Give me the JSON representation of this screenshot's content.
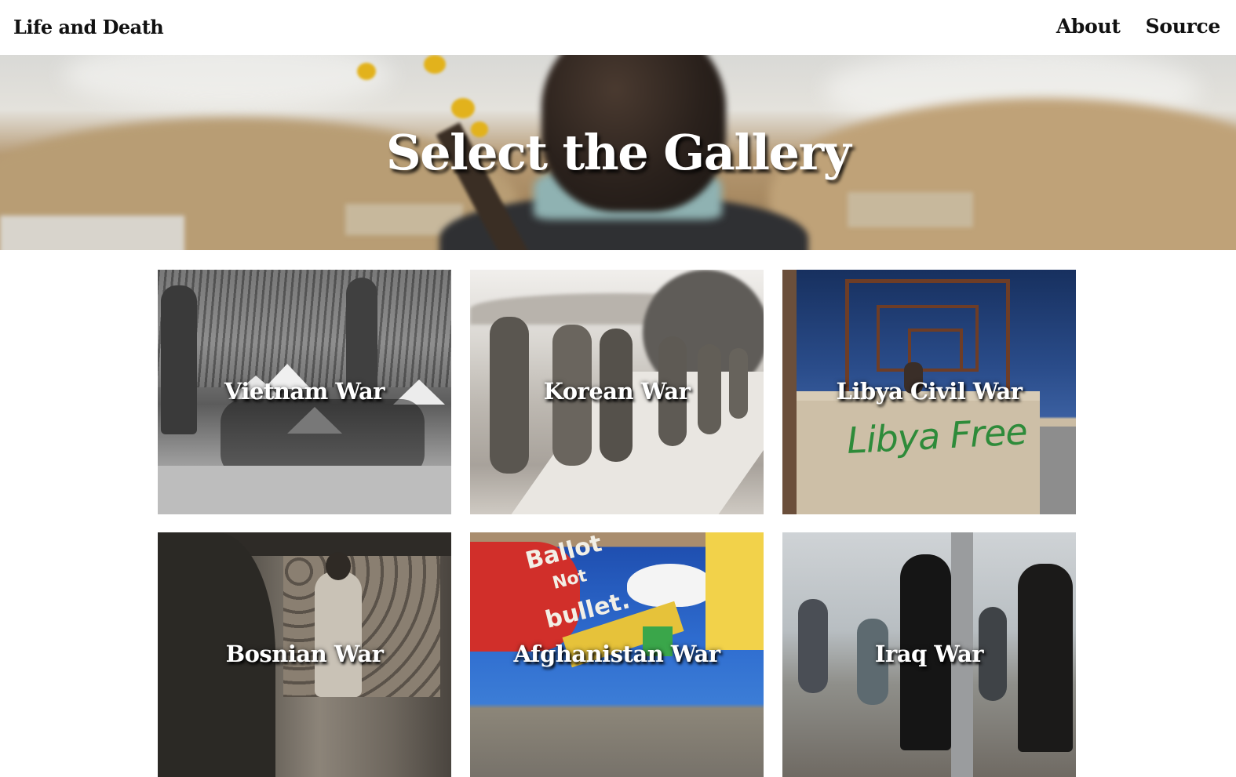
{
  "navbar": {
    "brand": "Life and Death",
    "links": [
      "About",
      "Source"
    ]
  },
  "hero": {
    "title": "Select the Gallery"
  },
  "gallery": {
    "cards": [
      {
        "label": "Vietnam War",
        "photo": "black-and-white photo of soldiers and villagers in conical hats"
      },
      {
        "label": "Korean War",
        "photo": "sepia photo of refugees walking along a path"
      },
      {
        "label": "Libya Civil War",
        "photo": "wall with green graffiti and metal frame against blue sky"
      },
      {
        "label": "Bosnian War",
        "photo": "black-and-white photo of woman walking past sandbags and soldier"
      },
      {
        "label": "Afghanistan War",
        "photo": "colorful mural with dove and children"
      },
      {
        "label": "Iraq War",
        "photo": "women and children walking in a dusty landscape"
      }
    ]
  },
  "mural_text": {
    "ballot": "Ballot",
    "not": "Not",
    "bullet": "bullet."
  },
  "graffiti_text": "Libya Free",
  "colors": {
    "text_dark": "#111111",
    "title_white": "#ffffff",
    "graffiti_green": "#2e8b3a"
  }
}
